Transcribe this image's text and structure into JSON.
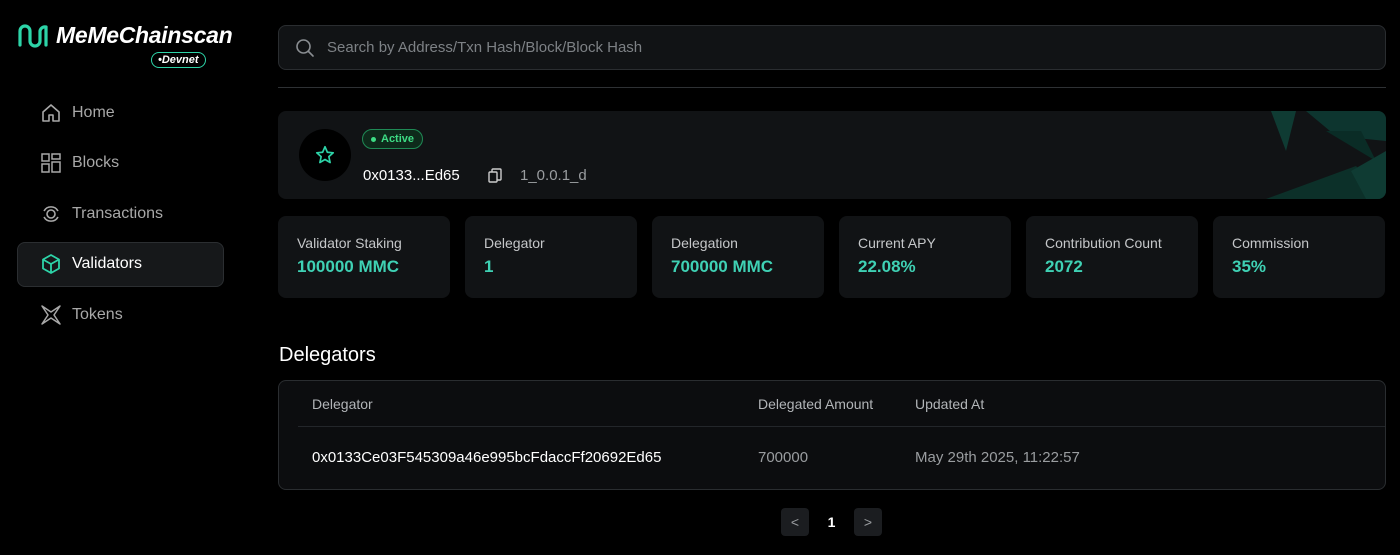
{
  "brand": {
    "name": "MeMeChainscan",
    "network_badge": "•Devnet",
    "accent": "#2dd4a8"
  },
  "sidebar": {
    "items": [
      {
        "label": "Home",
        "icon": "home-icon",
        "active": false
      },
      {
        "label": "Blocks",
        "icon": "blocks-grid-icon",
        "active": false
      },
      {
        "label": "Transactions",
        "icon": "transactions-icon",
        "active": false
      },
      {
        "label": "Validators",
        "icon": "cube-icon",
        "active": true
      },
      {
        "label": "Tokens",
        "icon": "tokens-star-icon",
        "active": false
      }
    ]
  },
  "search": {
    "placeholder": "Search by Address/Txn Hash/Block/Block Hash",
    "value": ""
  },
  "validator": {
    "status": "Active",
    "status_color": "#3ddc84",
    "address_short": "0x0133...Ed65",
    "version": "1_0.0.1_d"
  },
  "stats": [
    {
      "label": "Validator Staking",
      "value": "100000 MMC"
    },
    {
      "label": "Delegator",
      "value": "1"
    },
    {
      "label": "Delegation",
      "value": "700000 MMC"
    },
    {
      "label": "Current APY",
      "value": "22.08%"
    },
    {
      "label": "Contribution Count",
      "value": "2072"
    },
    {
      "label": "Commission",
      "value": "35%"
    }
  ],
  "delegators": {
    "title": "Delegators",
    "columns": [
      "Delegator",
      "Delegated Amount",
      "Updated At"
    ],
    "rows": [
      {
        "delegator": "0x0133Ce03F545309a46e995bcFdaccFf20692Ed65",
        "amount": "700000",
        "updated": "May 29th 2025, 11:22:57"
      }
    ]
  },
  "pagination": {
    "prev": "<",
    "current": "1",
    "next": ">"
  }
}
